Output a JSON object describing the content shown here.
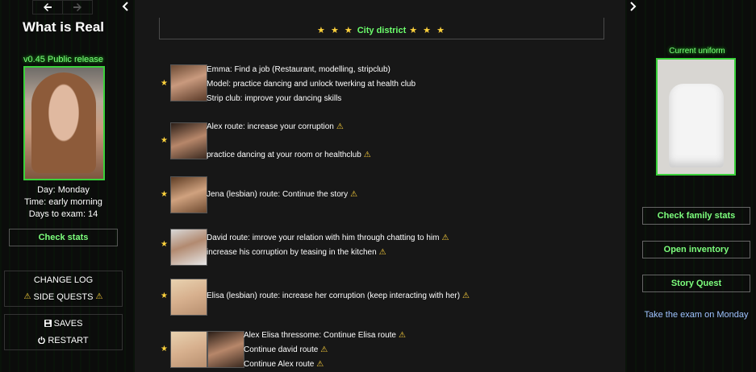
{
  "left": {
    "title": "What is Real",
    "version": "v0.45 Public release",
    "day": "Day: Monday",
    "time": "Time: early morning",
    "days_to_exam": "Days to exam: 14",
    "check_stats": "Check stats",
    "change_log": "CHANGE LOG",
    "side_quests": "SIDE QUESTS",
    "saves": "SAVES",
    "restart": "RESTART"
  },
  "main": {
    "district": "City district",
    "quests": [
      {
        "lines": [
          "Emma: Find a job (Restaurant, modelling, stripclub)",
          "Model: practice dancing and unlock twerking at health club",
          "Strip club: improve your dancing skills"
        ]
      },
      {
        "lines": [
          "Alex route: increase your corruption",
          "practice dancing at your room or healthclub"
        ]
      },
      {
        "lines": [
          "Jena (lesbian) route: Continue the story"
        ]
      },
      {
        "lines": [
          "David route: imrove your relation with him through chatting to him",
          "increase his corruption by teasing in the kitchen"
        ]
      },
      {
        "lines": [
          "Elisa (lesbian) route: increase her corruption (keep interacting with her)"
        ]
      },
      {
        "lines": [
          "Alex Elisa thressome: Continue Elisa route",
          "Continue david route",
          "Continue Alex route"
        ]
      }
    ]
  },
  "right": {
    "uniform_label": "Current uniform",
    "check_family": "Check family stats",
    "open_inventory": "Open inventory",
    "story_quest": "Story Quest",
    "exam_note": "Take the exam on Monday"
  },
  "colors": {
    "accent_green": "#7dff7d",
    "star_yellow": "#ffd23c",
    "note_blue": "#9fc3ff"
  }
}
